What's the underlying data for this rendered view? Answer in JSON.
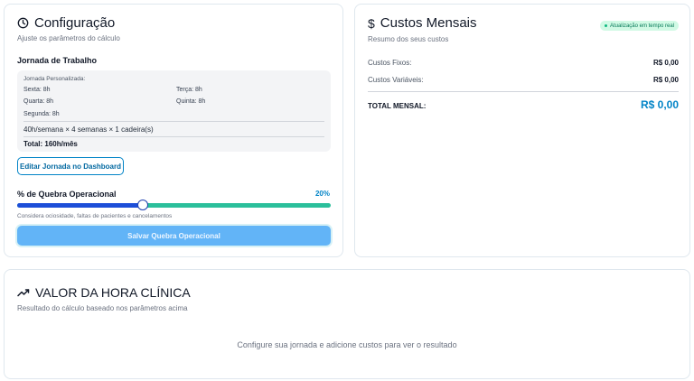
{
  "config": {
    "title": "Configuração",
    "subtitle": "Ajuste os parâmetros do cálculo",
    "section_title": "Jornada de Trabalho",
    "jornada": {
      "label": "Jornada Personalizada:",
      "days": {
        "sexta": "Sexta: 8h",
        "terca": "Terça: 8h",
        "quarta": "Quarta: 8h",
        "quinta": "Quinta: 8h",
        "segunda": "Segunda: 8h"
      },
      "formula": "40h/semana × 4 semanas × 1 cadeira(s)",
      "total": "Total: 160h/mês"
    },
    "edit_button": "Editar Jornada no Dashboard",
    "quebra": {
      "label": "% de Quebra Operacional",
      "value_text": "20%",
      "value": 20,
      "hint": "Considera ociosidade, faltas de pacientes e cancelamentos"
    },
    "save_button": "Salvar Quebra Operacional"
  },
  "costs": {
    "icon": "$",
    "title": "Custos Mensais",
    "subtitle": "Resumo dos seus custos",
    "badge": "Atualização em tempo real",
    "fixed_label": "Custos Fixos:",
    "fixed_value": "R$ 0,00",
    "variable_label": "Custos Variáveis:",
    "variable_value": "R$ 0,00",
    "total_label": "TOTAL MENSAL:",
    "total_value": "R$ 0,00"
  },
  "hour": {
    "title": "VALOR DA HORA CLÍNICA",
    "subtitle": "Resultado do cálculo baseado nos parâmetros acima",
    "empty_message": "Configure sua jornada e adicione custos para ver o resultado"
  },
  "colors": {
    "accent": "#0284c7",
    "slider_fill": "#1d4ed8",
    "slider_rest": "#2bbf9b",
    "primary_button": "#62b4f7",
    "badge_bg": "#d1fae5"
  }
}
